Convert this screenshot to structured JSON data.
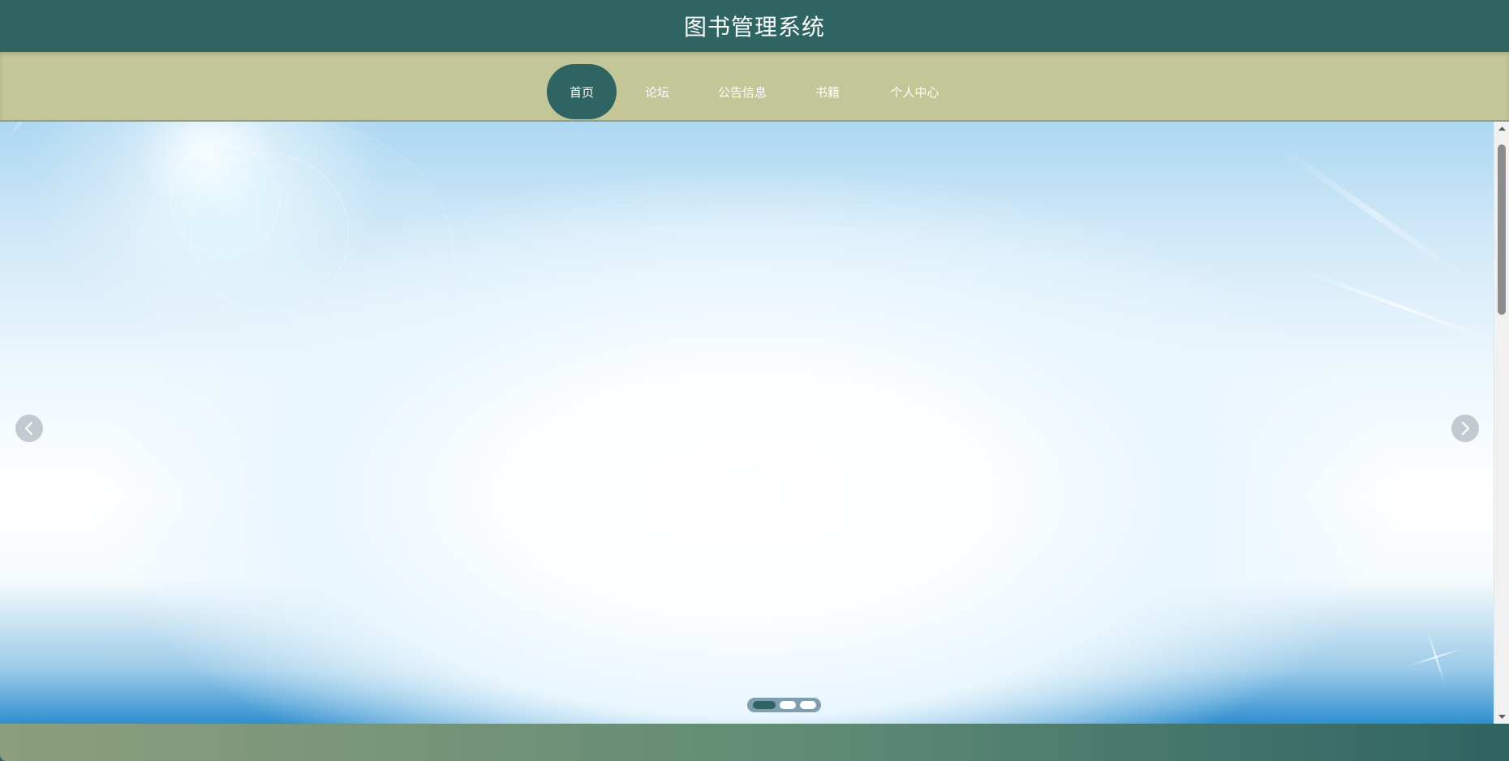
{
  "header": {
    "title": "图书管理系统"
  },
  "nav": {
    "items": [
      {
        "label": "首页",
        "active": true
      },
      {
        "label": "论坛",
        "active": false
      },
      {
        "label": "公告信息",
        "active": false
      },
      {
        "label": "书籍",
        "active": false
      },
      {
        "label": "个人中心",
        "active": false
      }
    ]
  },
  "carousel": {
    "slide_count": 3,
    "active_slide": 1,
    "prev_icon": "chevron-left-icon",
    "next_icon": "chevron-right-icon"
  },
  "colors": {
    "primary": "#2e6461",
    "nav_background": "#c3c696",
    "nav_text": "#ffffff",
    "indicator_inactive": "#ffffff"
  }
}
